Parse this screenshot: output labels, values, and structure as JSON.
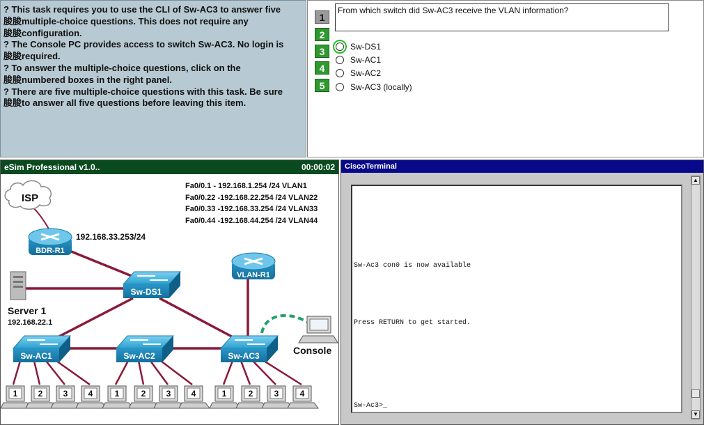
{
  "instructions": {
    "lines": [
      " ? This task requires you to use the CLI of Sw-AC3 to answer five",
      "朘朘multiple-choice questions. This does not require any",
      "朘朘configuration.",
      " ? The Console PC provides access to switch Sw-AC3.  No login is",
      "朘朘required.",
      " ? To answer the multiple-choice questions, click on the",
      "朘朘numbered boxes in the right panel.",
      " ? There are five multiple-choice questions with this task. Be sure",
      "朘朘to answer all five questions before leaving this item."
    ]
  },
  "question_panel": {
    "numbers": [
      "1",
      "2",
      "3",
      "4",
      "5"
    ],
    "question": "From which switch did Sw-AC3 receive the VLAN information?",
    "options": [
      "Sw-DS1",
      "Sw-AC1",
      "Sw-AC2",
      "Sw-AC3 (locally)"
    ]
  },
  "esim": {
    "title": "eSim Professional v1.0..",
    "timer": "00:00:02",
    "subinterfaces": [
      "Fa0/0.1  -  192.168.1.254   /24  VLAN1",
      "Fa0/0.22  -192.168.22.254 /24  VLAN22",
      "Fa0/0.33  -192.168.33.254 /24  VLAN33",
      "Fa0/0.44  -192.168.44.254 /24  VLAN44"
    ],
    "isp_label": "ISP",
    "router_bdr": "BDR-R1",
    "router_bdr_ip": "192.168.33.253/24",
    "router_vlan": "VLAN-R1",
    "switch_ds": "Sw-DS1",
    "switch_ac1": "Sw-AC1",
    "switch_ac2": "Sw-AC2",
    "switch_ac3": "Sw-AC3",
    "server_label": "Server 1",
    "server_ip": "192.168.22.1",
    "console_label": "Console",
    "pc_numbers": [
      "1",
      "2",
      "3",
      "4"
    ]
  },
  "terminal": {
    "title": "CiscoTerminal",
    "line1": "Sw-Ac3 con0 is now available",
    "line2": "Press RETURN to get started.",
    "prompt": "Sw-Ac3>_"
  },
  "colors": {
    "instr_bg": "#b7c9d2",
    "number_green": "#2e9a2e",
    "esim_title": "#0a4a1f",
    "term_title": "#08088a",
    "cable": "#8b1a3a",
    "device_blue": "#1c8cc0"
  }
}
